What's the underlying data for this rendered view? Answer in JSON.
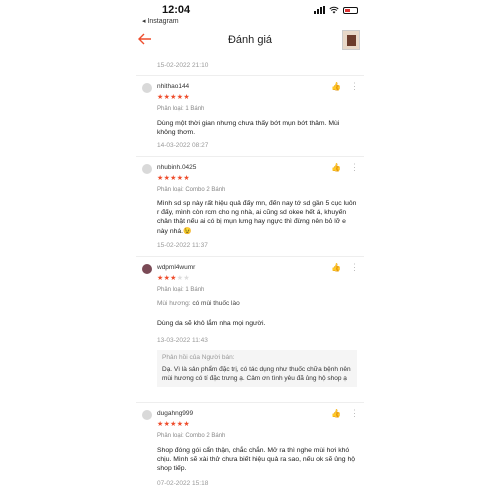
{
  "status_bar": {
    "time": "12:04",
    "back_app": "◂ Instagram"
  },
  "header": {
    "title": "Đánh giá"
  },
  "top_date": "15-02-2022 21:10",
  "reviews": [
    {
      "username": "nhithao144",
      "rating": 5,
      "variant": "Phân loại: 1 Bánh",
      "text": "Dùng một thời gian nhưng chưa thấy bớt mụn bớt thâm. Mùi không thơm.",
      "date": "14-03-2022 08:27"
    },
    {
      "username": "nhubinh.0425",
      "rating": 5,
      "variant": "Phân loại: Combo 2 Bánh",
      "text": "Mình sd sp này rất hiệu quả đấy mn, đến nay tớ sd gần 5 cục luôn r đấy, mình còn rcm cho ng nhà, ai cũng sd okee hết á, khuyến chân thật nếu ai có bị mụn lưng hay ngực thì đừng nên bỏ lỡ e này nhá.😉",
      "date": "15-02-2022 11:37"
    },
    {
      "username": "wdpml4wumr",
      "rating": 3,
      "variant": "Phân loại: 1 Bánh",
      "smell_key": "Mùi hương:",
      "smell_val": "có mùi thuốc lào",
      "text": "Dùng da sẽ khô lắm nha mọi người.",
      "date": "13-03-2022 11:43",
      "seller_reply": {
        "title": "Phản hồi của Người bán:",
        "text": "Dạ. Vì là sản phẩm đặc trị, có tác dụng như thuốc chữa bệnh nên mùi hương có tí đặc trưng ạ. Cảm ơn tình yêu đã ủng hộ shop ạ"
      }
    },
    {
      "username": "dugahng999",
      "rating": 5,
      "variant": "Phân loại: Combo 2 Bánh",
      "text": "Shop đóng gói cẩn thận, chắc chắn. Mở ra thì nghe mùi hơi khó chịu. Mình sẽ xài thử chưa biết hiệu quả ra sao, nếu ok sẽ ủng hộ shop tiếp.",
      "date": "07-02-2022 15:18"
    }
  ],
  "icons": {
    "like": "thumbs-up-icon",
    "more": "more-vertical-icon",
    "back": "arrow-left-icon",
    "star": "star-icon"
  },
  "colors": {
    "accent": "#ee4d2d",
    "muted": "#999999"
  }
}
